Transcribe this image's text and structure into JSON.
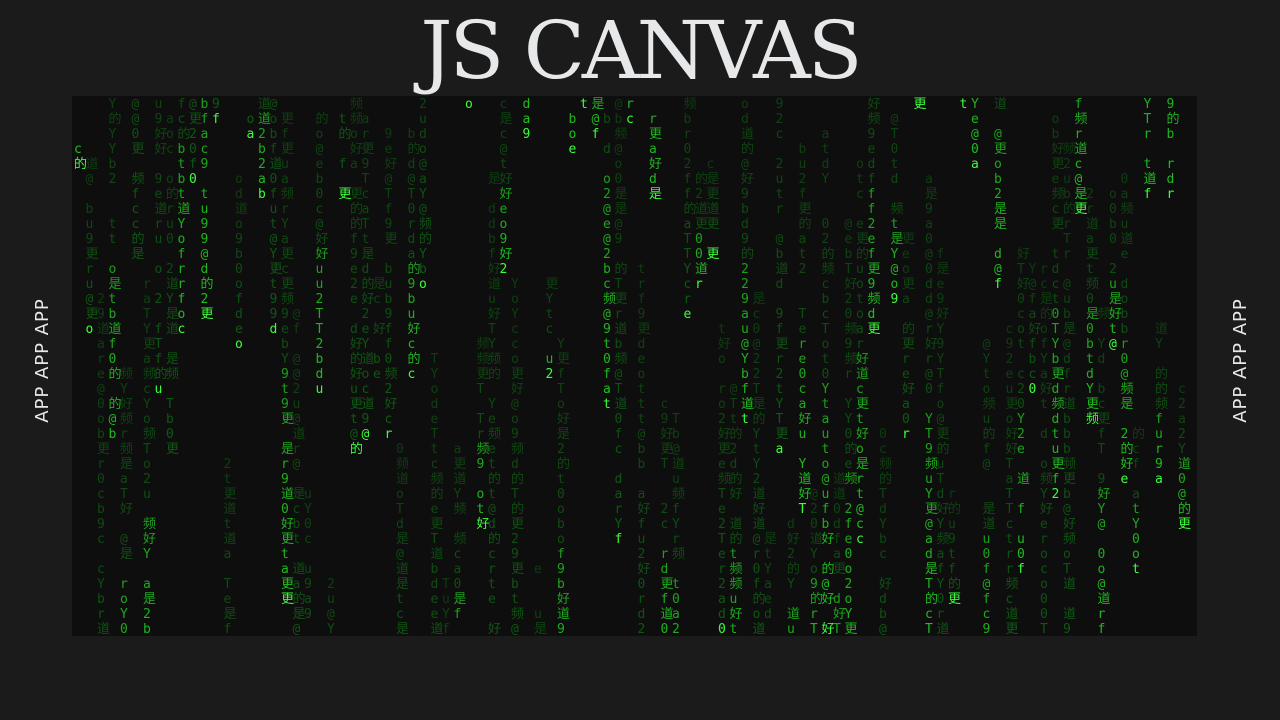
{
  "page": {
    "title": "JS CANVAS",
    "side_label_left": "APP APP APP",
    "side_label_right": "APP APP APP"
  },
  "colors": {
    "background": "#1b1b1b",
    "canvas_background": "#0e0e0e",
    "title_text": "#e6e8ea",
    "glyph_bright": "#3bff3b",
    "glyph_mid": "#1fbf1f",
    "glyph_dim": "#0f5f14"
  },
  "rain": {
    "charset": "do0bu9Y@efTacrt2是的好频更道"
  }
}
